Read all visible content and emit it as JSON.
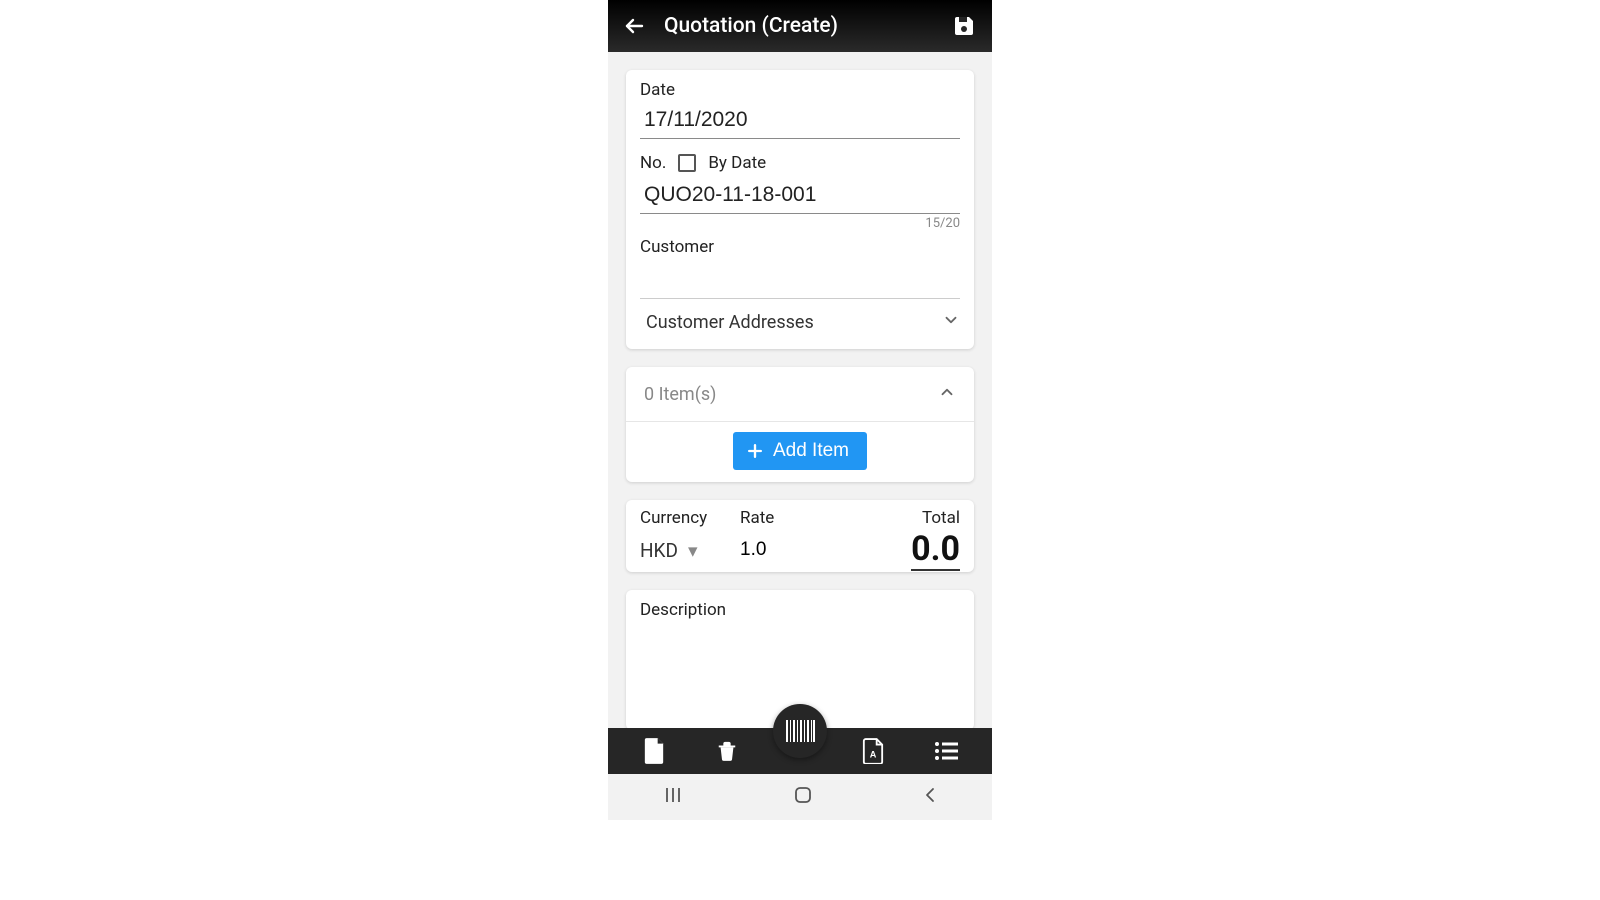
{
  "appbar": {
    "title": "Quotation (Create)"
  },
  "form": {
    "date_label": "Date",
    "date_value": "17/11/2020",
    "no_label": "No.",
    "by_date_label": "By Date",
    "by_date_checked": false,
    "no_value": "QUO20-11-18-001",
    "no_counter": "15/20",
    "customer_label": "Customer",
    "customer_value": "",
    "customer_addresses_label": "Customer Addresses"
  },
  "items": {
    "count_label": "0 Item(s)",
    "add_label": "Add Item"
  },
  "currency": {
    "currency_label": "Currency",
    "currency_value": "HKD",
    "rate_label": "Rate",
    "rate_value": "1.0",
    "total_label": "Total",
    "total_value": "0.0"
  },
  "description": {
    "label": "Description",
    "value": ""
  }
}
